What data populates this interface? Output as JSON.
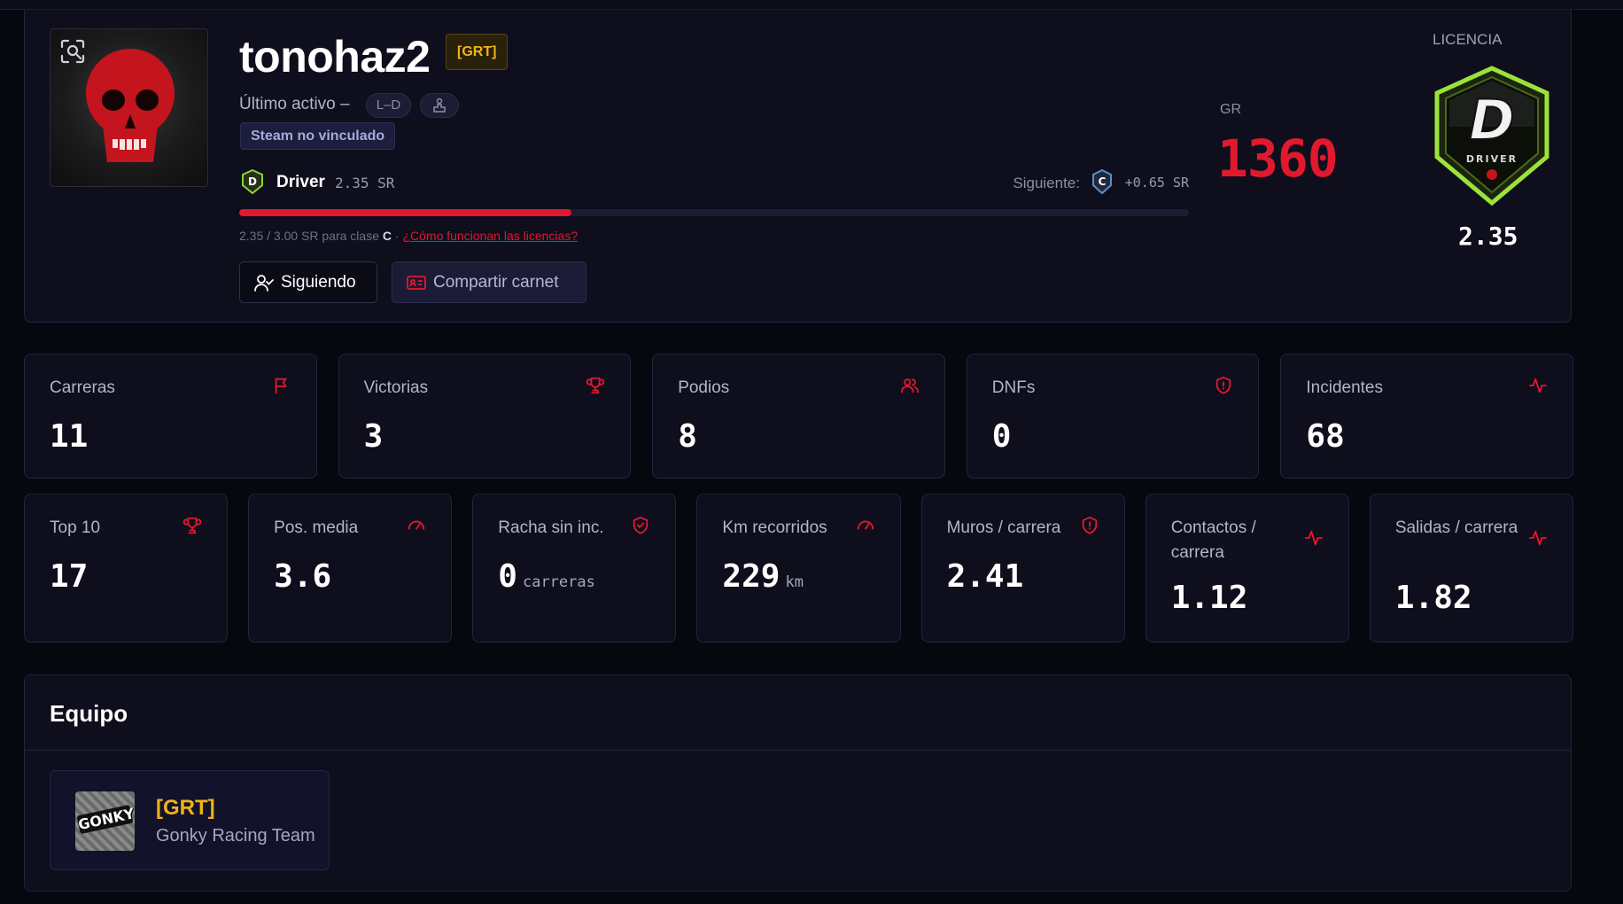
{
  "profile": {
    "username": "tonohaz2",
    "team_tag": "[GRT]",
    "last_active": "Último activo –",
    "pill_days": "L–D",
    "steam_status": "Steam no vinculado",
    "license_name": "Driver",
    "license_sr": "2.35  SR",
    "next_label": "Siguiente:",
    "next_sr": "+0.65  SR",
    "progress_fraction": 0.35,
    "progress_text": "2.35 / 3.00 SR para clase ",
    "progress_class": "C",
    "progress_sep": " · ",
    "license_help_link": "¿Cómo funcionan las licencias?",
    "follow_button": "Siguiendo",
    "share_button": "Compartir carnet",
    "gr_label": "GR",
    "gr_value": "1360",
    "licencia_label": "LICENCIA",
    "badge_letter": "D",
    "badge_word": "DRIVER",
    "badge_sr": "2.35"
  },
  "stats_row1": [
    {
      "label": "Carreras",
      "value": "11",
      "icon": "flag-icon"
    },
    {
      "label": "Victorias",
      "value": "3",
      "icon": "trophy-icon"
    },
    {
      "label": "Podios",
      "value": "8",
      "icon": "users-icon"
    },
    {
      "label": "DNFs",
      "value": "0",
      "icon": "shield-alert-icon"
    },
    {
      "label": "Incidentes",
      "value": "68",
      "icon": "activity-icon"
    }
  ],
  "stats_row2": [
    {
      "label": "Top 10",
      "value": "17",
      "unit": "",
      "icon": "trophy-icon"
    },
    {
      "label": "Pos. media",
      "value": "3.6",
      "unit": "",
      "icon": "gauge-icon"
    },
    {
      "label": "Racha sin inc.",
      "value": "0",
      "unit": "carreras",
      "icon": "shield-check-icon"
    },
    {
      "label": "Km recorridos",
      "value": "229",
      "unit": "km",
      "icon": "gauge-icon"
    },
    {
      "label": "Muros / carrera",
      "value": "2.41",
      "unit": "",
      "icon": "shield-alert-icon"
    },
    {
      "label": "Contactos / carrera",
      "value": "1.12",
      "unit": "",
      "icon": "activity-icon"
    },
    {
      "label": "Salidas / carrera",
      "value": "1.82",
      "unit": "",
      "icon": "activity-icon"
    }
  ],
  "team": {
    "section_title": "Equipo",
    "tag": "[GRT]",
    "name": "Gonky Racing Team",
    "logo_text": "GONKY"
  },
  "colors": {
    "accent": "#e0192f",
    "team_gold": "#f0b21a",
    "background": "#07070f",
    "card": "#0e0e1c"
  }
}
